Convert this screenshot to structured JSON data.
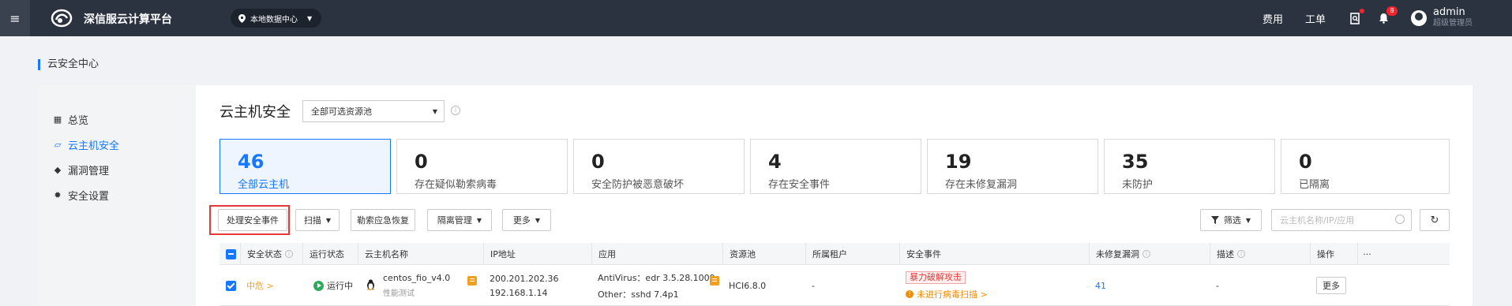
{
  "topbar": {
    "brand": "深信服云计算平台",
    "datacenter": "本地数据中心",
    "links": [
      "费用",
      "工单"
    ],
    "notification_count": "8",
    "user_name": "admin",
    "user_role": "超级管理员"
  },
  "page_title": "云安全中心",
  "sidebar": {
    "items": [
      {
        "label": "总览",
        "icon": "grid-icon"
      },
      {
        "label": "云主机安全",
        "icon": "host-security-icon"
      },
      {
        "label": "漏洞管理",
        "icon": "layers-icon"
      },
      {
        "label": "安全设置",
        "icon": "gear-icon"
      }
    ],
    "active_index": 1
  },
  "main": {
    "title": "云主机安全",
    "pool_select": "全部可选资源池",
    "stats": [
      {
        "value": "46",
        "label": "全部云主机"
      },
      {
        "value": "0",
        "label": "存在疑似勒索病毒"
      },
      {
        "value": "0",
        "label": "安全防护被恶意破坏"
      },
      {
        "value": "4",
        "label": "存在安全事件"
      },
      {
        "value": "19",
        "label": "存在未修复漏洞"
      },
      {
        "value": "35",
        "label": "未防护"
      },
      {
        "value": "0",
        "label": "已隔离"
      }
    ],
    "toolbar": {
      "handle_events": "处理安全事件",
      "scan": "扫描",
      "ransom_recovery": "勒索应急恢复",
      "isolation": "隔离管理",
      "more": "更多",
      "filter": "筛选",
      "search_placeholder": "云主机名称/IP/应用"
    },
    "table": {
      "columns": [
        "安全状态",
        "运行状态",
        "云主机名称",
        "IP地址",
        "应用",
        "资源池",
        "所属租户",
        "安全事件",
        "未修复漏洞",
        "描述",
        "操作"
      ],
      "rows": [
        {
          "security_status": "中危 >",
          "run_status": "运行中",
          "name": "centos_fio_v4.0",
          "subname": "性能测试",
          "ip1": "200.201.202.36",
          "ip2": "192.168.1.14",
          "app1": "AntiVirus：edr 3.5.28.1009",
          "app2": "Other：sshd 7.4p1",
          "pool": "HCI6.8.0",
          "tenant": "-",
          "event_tag": "暴力破解攻击",
          "event_warn": "未进行病毒扫描 >",
          "vulns": "41",
          "desc": "-",
          "action": "更多"
        }
      ]
    }
  }
}
